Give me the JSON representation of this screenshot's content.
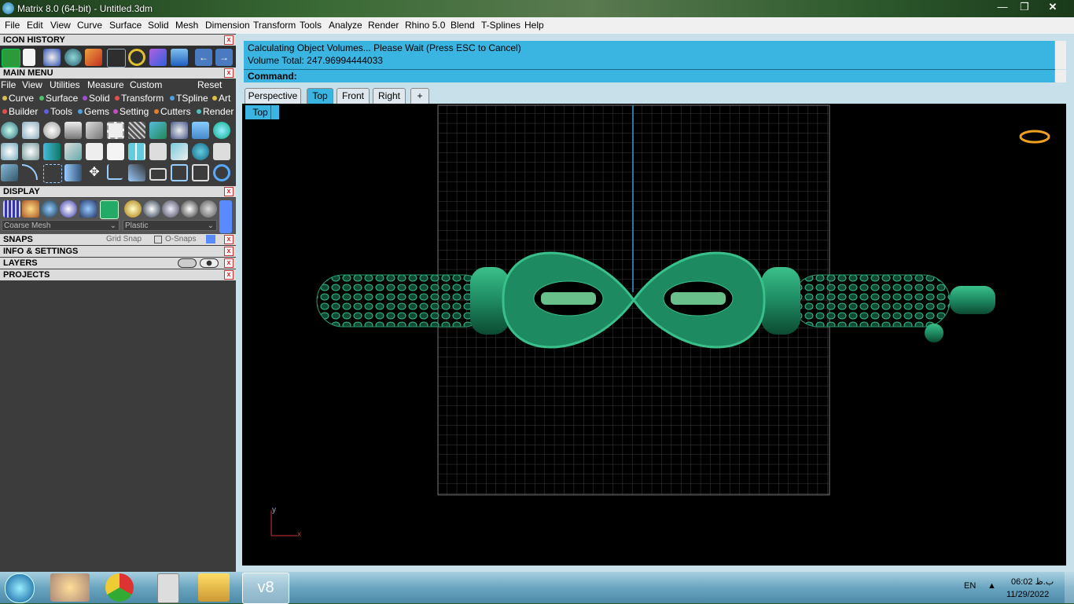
{
  "window": {
    "title": "Matrix 8.0 (64-bit) - Untitled.3dm",
    "app_icon": "matrix-app-icon"
  },
  "menubar": [
    "File",
    "Edit",
    "View",
    "Curve",
    "Surface",
    "Solid",
    "Mesh",
    "Dimension",
    "Transform",
    "Tools",
    "Analyze",
    "Render",
    "Rhino 5.0",
    "Blend",
    "T-Splines",
    "Help"
  ],
  "left_panel": {
    "icon_history": {
      "title": "ICON HISTORY"
    },
    "main_menu": {
      "title": "MAIN MENU",
      "top_items": [
        "File",
        "View",
        "Utilities",
        "Measure",
        "Custom"
      ],
      "reset": "Reset",
      "row1": [
        {
          "label": "Curve",
          "color": "#d8c050"
        },
        {
          "label": "Surface",
          "color": "#50c070"
        },
        {
          "label": "Solid",
          "color": "#a050d0"
        },
        {
          "label": "Transform",
          "color": "#e05050"
        },
        {
          "label": "TSpline",
          "color": "#50a0e0"
        },
        {
          "label": "Art",
          "color": "#e0c040"
        }
      ],
      "row2": [
        {
          "label": "Builder",
          "color": "#e05050"
        },
        {
          "label": "Tools",
          "color": "#6060e0"
        },
        {
          "label": "Gems",
          "color": "#50a0e0"
        },
        {
          "label": "Setting",
          "color": "#c050c0"
        },
        {
          "label": "Cutters",
          "color": "#e08030"
        },
        {
          "label": "Render",
          "color": "#50c0c0"
        }
      ]
    },
    "display": {
      "title": "DISPLAY",
      "mesh_select": "Coarse Mesh",
      "material_select": "Plastic"
    },
    "snaps": {
      "title": "SNAPS",
      "grid_snap": "Grid Snap",
      "osnaps": "O-Snaps"
    },
    "info": {
      "title": "INFO & SETTINGS"
    },
    "layers": {
      "title": "LAYERS"
    },
    "projects": {
      "title": "PROJECTS"
    }
  },
  "command": {
    "line1": "Calculating Object Volumes... Please Wait (Press ESC to Cancel)",
    "line2": "Volume Total: 247.96994444033",
    "prompt": "Command:"
  },
  "viewport_tabs": [
    "Perspective",
    "Top",
    "Front",
    "Right"
  ],
  "active_tab": "Top",
  "viewport": {
    "label": "Top",
    "axis_x": "x",
    "axis_y": "y"
  },
  "taskbar": {
    "apps": [
      "start-button",
      "paint-icon",
      "chrome-icon",
      "calculator-icon",
      "file-explorer-icon",
      "matrix-v8-icon"
    ],
    "language": "EN",
    "time": "06:02 ب.ظ",
    "date": "11/29/2022"
  },
  "colors": {
    "accent": "#3ab4e0",
    "model": "#1e8a62",
    "grid": "#3a3a3a"
  }
}
